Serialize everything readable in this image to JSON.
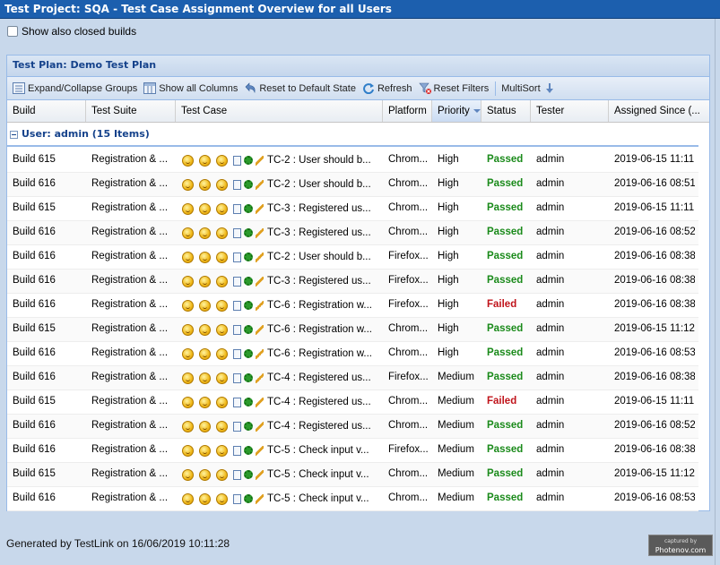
{
  "window": {
    "title": "Test Project: SQA - Test Case Assignment Overview for all Users"
  },
  "options": {
    "show_closed_label": "Show also closed builds"
  },
  "panel": {
    "title": "Test Plan: Demo Test Plan"
  },
  "toolbar": {
    "expand": "Expand/Collapse Groups",
    "show_columns": "Show all Columns",
    "reset_state": "Reset to Default State",
    "refresh": "Refresh",
    "reset_filters": "Reset Filters",
    "multisort": "MultiSort"
  },
  "columns": [
    "Build",
    "Test Suite",
    "Test Case",
    "Platform",
    "Priority",
    "Status",
    "Tester",
    "Assigned Since (..."
  ],
  "group": {
    "label": "User: admin (15 Items)"
  },
  "rows": [
    {
      "build": "Build 615",
      "suite": "Registration & ...",
      "tc": "TC-2 : User should b...",
      "platform": "Chrom...",
      "priority": "High",
      "status": "Passed",
      "tester": "admin",
      "since": "2019-06-15 11:11..."
    },
    {
      "build": "Build 616",
      "suite": "Registration & ...",
      "tc": "TC-2 : User should b...",
      "platform": "Chrom...",
      "priority": "High",
      "status": "Passed",
      "tester": "admin",
      "since": "2019-06-16 08:51..."
    },
    {
      "build": "Build 615",
      "suite": "Registration & ...",
      "tc": "TC-3 : Registered us...",
      "platform": "Chrom...",
      "priority": "High",
      "status": "Passed",
      "tester": "admin",
      "since": "2019-06-15 11:11..."
    },
    {
      "build": "Build 616",
      "suite": "Registration & ...",
      "tc": "TC-3 : Registered us...",
      "platform": "Chrom...",
      "priority": "High",
      "status": "Passed",
      "tester": "admin",
      "since": "2019-06-16 08:52..."
    },
    {
      "build": "Build 616",
      "suite": "Registration & ...",
      "tc": "TC-2 : User should b...",
      "platform": "Firefox...",
      "priority": "High",
      "status": "Passed",
      "tester": "admin",
      "since": "2019-06-16 08:38..."
    },
    {
      "build": "Build 616",
      "suite": "Registration & ...",
      "tc": "TC-3 : Registered us...",
      "platform": "Firefox...",
      "priority": "High",
      "status": "Passed",
      "tester": "admin",
      "since": "2019-06-16 08:38..."
    },
    {
      "build": "Build 616",
      "suite": "Registration & ...",
      "tc": "TC-6 : Registration w...",
      "platform": "Firefox...",
      "priority": "High",
      "status": "Failed",
      "tester": "admin",
      "since": "2019-06-16 08:38..."
    },
    {
      "build": "Build 615",
      "suite": "Registration & ...",
      "tc": "TC-6 : Registration w...",
      "platform": "Chrom...",
      "priority": "High",
      "status": "Passed",
      "tester": "admin",
      "since": "2019-06-15 11:12..."
    },
    {
      "build": "Build 616",
      "suite": "Registration & ...",
      "tc": "TC-6 : Registration w...",
      "platform": "Chrom...",
      "priority": "High",
      "status": "Passed",
      "tester": "admin",
      "since": "2019-06-16 08:53..."
    },
    {
      "build": "Build 616",
      "suite": "Registration & ...",
      "tc": "TC-4 : Registered us...",
      "platform": "Firefox...",
      "priority": "Medium",
      "status": "Passed",
      "tester": "admin",
      "since": "2019-06-16 08:38..."
    },
    {
      "build": "Build 615",
      "suite": "Registration & ...",
      "tc": "TC-4 : Registered us...",
      "platform": "Chrom...",
      "priority": "Medium",
      "status": "Failed",
      "tester": "admin",
      "since": "2019-06-15 11:11..."
    },
    {
      "build": "Build 616",
      "suite": "Registration & ...",
      "tc": "TC-4 : Registered us...",
      "platform": "Chrom...",
      "priority": "Medium",
      "status": "Passed",
      "tester": "admin",
      "since": "2019-06-16 08:52..."
    },
    {
      "build": "Build 616",
      "suite": "Registration & ...",
      "tc": "TC-5 : Check input v...",
      "platform": "Firefox...",
      "priority": "Medium",
      "status": "Passed",
      "tester": "admin",
      "since": "2019-06-16 08:38..."
    },
    {
      "build": "Build 615",
      "suite": "Registration & ...",
      "tc": "TC-5 : Check input v...",
      "platform": "Chrom...",
      "priority": "Medium",
      "status": "Passed",
      "tester": "admin",
      "since": "2019-06-15 11:12..."
    },
    {
      "build": "Build 616",
      "suite": "Registration & ...",
      "tc": "TC-5 : Check input v...",
      "platform": "Chrom...",
      "priority": "Medium",
      "status": "Passed",
      "tester": "admin",
      "since": "2019-06-16 08:53..."
    }
  ],
  "footer": {
    "text": "Generated by TestLink on 16/06/2019 10:11:28"
  },
  "watermark": {
    "line1": "captured by",
    "line2": "Photenov.com"
  },
  "colors": {
    "titlebar": "#1c5fae",
    "passed": "#1a8a1a",
    "failed": "#c0141b",
    "group": "#15428b"
  }
}
